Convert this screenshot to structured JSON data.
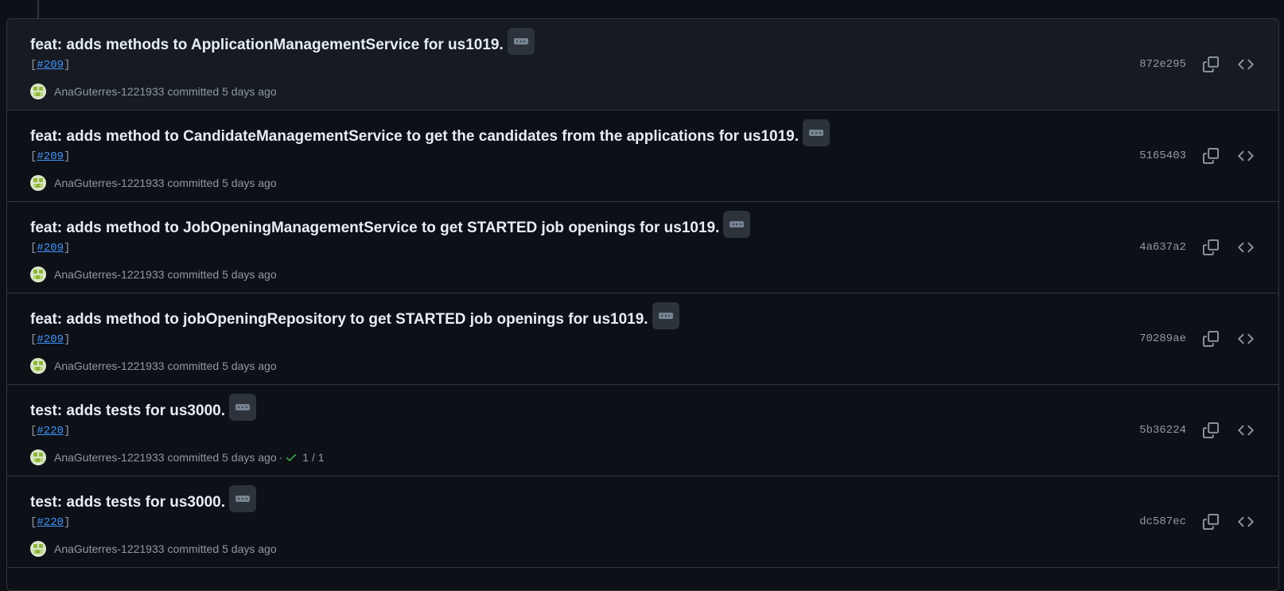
{
  "colors": {
    "background": "#0d1117",
    "row_hover": "#161b22",
    "border": "#30363d",
    "link": "#4493f8",
    "muted": "#9198a1",
    "success": "#3fb950"
  },
  "commits": [
    {
      "title": "feat: adds methods to ApplicationManagementService for us1019.",
      "desc_open": "[",
      "issue": "#209",
      "desc_close": "]",
      "author": "AnaGuterres-1221933",
      "committed": "committed",
      "time": "5 days ago",
      "sha": "872e295",
      "checks": null
    },
    {
      "title": "feat: adds method to CandidateManagementService to get the candidates from the applications for us1019.",
      "desc_open": "[",
      "issue": "#209",
      "desc_close": "]",
      "author": "AnaGuterres-1221933",
      "committed": "committed",
      "time": "5 days ago",
      "sha": "5165403",
      "checks": null
    },
    {
      "title": "feat: adds method to JobOpeningManagementService to get STARTED job openings for us1019.",
      "desc_open": "[",
      "issue": "#209",
      "desc_close": "]",
      "author": "AnaGuterres-1221933",
      "committed": "committed",
      "time": "5 days ago",
      "sha": "4a637a2",
      "checks": null
    },
    {
      "title": "feat: adds method to jobOpeningRepository to get STARTED job openings for us1019.",
      "desc_open": "[",
      "issue": "#209",
      "desc_close": "]",
      "author": "AnaGuterres-1221933",
      "committed": "committed",
      "time": "5 days ago",
      "sha": "70289ae",
      "checks": null
    },
    {
      "title": "test: adds tests for us3000.",
      "desc_open": "[",
      "issue": "#220",
      "desc_close": "]",
      "author": "AnaGuterres-1221933",
      "committed": "committed",
      "time": "5 days ago",
      "sha": "5b36224",
      "checks": {
        "sep": "·",
        "count": "1 / 1"
      }
    },
    {
      "title": "test: adds tests for us3000.",
      "desc_open": "[",
      "issue": "#220",
      "desc_close": "]",
      "author": "AnaGuterres-1221933",
      "committed": "committed",
      "time": "5 days ago",
      "sha": "dc587ec",
      "checks": null
    }
  ]
}
